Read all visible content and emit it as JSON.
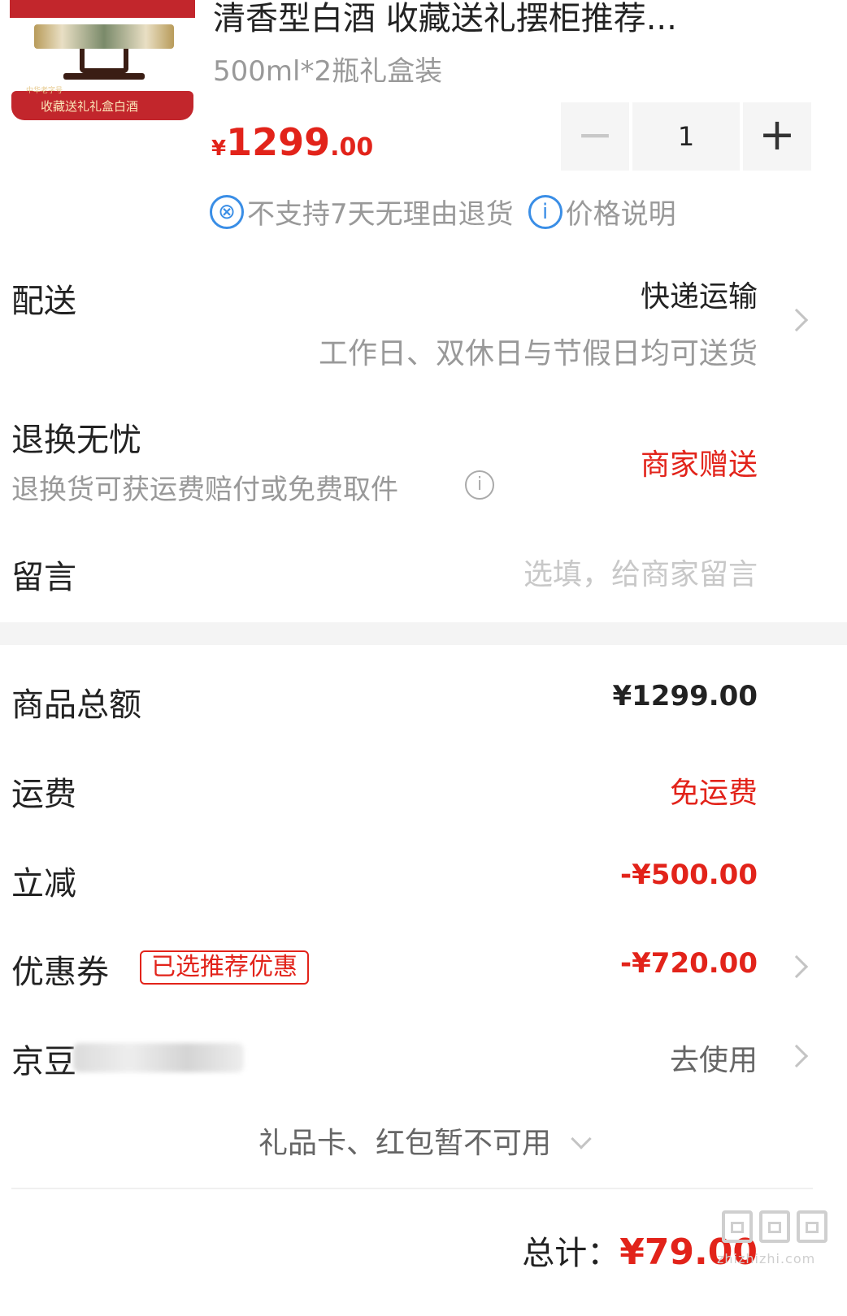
{
  "product": {
    "image_text": "收藏送礼礼盒白酒",
    "image_small_text": "中华老字号",
    "title": "清香型白酒 收藏送礼摆柜推荐...",
    "spec": "500ml*2瓶礼盒装",
    "price_currency": "¥",
    "price_integer": "1299",
    "price_decimal": ".00",
    "quantity": "1",
    "minus_symbol": "−",
    "plus_symbol": "+",
    "tags": [
      {
        "icon": "no-return-icon",
        "glyph": "⊗",
        "text": "不支持7天无理由退货"
      },
      {
        "icon": "info-icon",
        "glyph": "i",
        "text": "价格说明"
      }
    ]
  },
  "delivery": {
    "label": "配送",
    "method": "快递运输",
    "note": "工作日、双休日与节假日均可送货"
  },
  "returns": {
    "label": "退换无忧",
    "desc": "退换货可获运费赔付或免费取件",
    "info_glyph": "i",
    "value": "商家赠送"
  },
  "message": {
    "label": "留言",
    "placeholder": "选填，给商家留言"
  },
  "summary": {
    "goods_total_label": "商品总额",
    "goods_total_value": "¥1299.00",
    "shipping_label": "运费",
    "shipping_value": "免运费",
    "discount_label": "立减",
    "discount_value": "-¥500.00",
    "coupon_label": "优惠券",
    "coupon_badge": "已选推荐优惠",
    "coupon_value": "-¥720.00",
    "jingdou_label": "京豆",
    "jingdou_value": "去使用",
    "giftcard_text": "礼品卡、红包暂不可用"
  },
  "footer": {
    "total_label": "总计：",
    "total_value": "¥79.00",
    "watermark_url": "zhizhizhi.com"
  },
  "colors": {
    "accent_red": "#e2231a",
    "info_blue": "#3a8ee6",
    "muted_gray": "#999999"
  }
}
